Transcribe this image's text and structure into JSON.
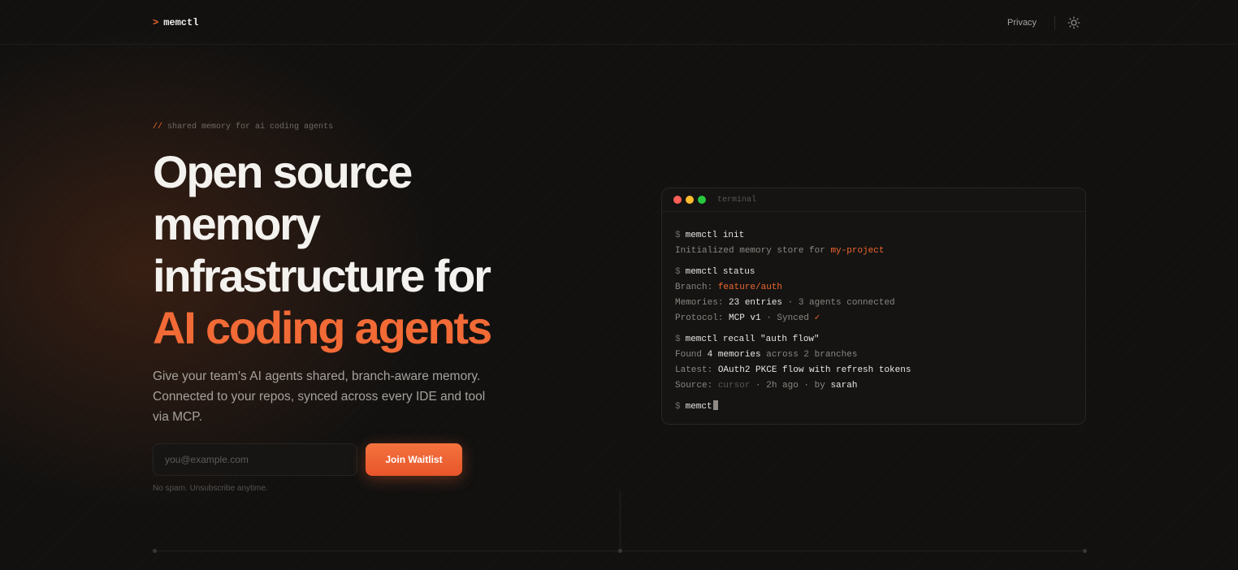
{
  "nav": {
    "logo_prompt": ">",
    "logo_text": "memctl",
    "privacy_link": "Privacy",
    "theme_toggle_icon": "sun-icon"
  },
  "hero": {
    "kicker_prefix": "//",
    "kicker_text": "shared memory for ai coding agents",
    "headline_lines": [
      "Open source",
      "memory",
      "infrastructure for"
    ],
    "headline_accent": "AI coding agents",
    "subtext": "Give your team's AI agents shared, branch-aware memory. Connected to your repos, synced across every IDE and tool via MCP.",
    "email_placeholder": "you@example.com",
    "email_value": "",
    "join_button": "Join Waitlist",
    "fineprint": "No spam. Unsubscribe anytime."
  },
  "terminal": {
    "title": "terminal",
    "prompt_symbol": "$",
    "cmd1": "memctl init",
    "out1_text": "Initialized memory store for ",
    "out1_project": "my-project",
    "cmd2": "memctl status",
    "branch_label": "Branch: ",
    "branch_value": "feature/auth",
    "memories_label": "Memories: ",
    "memories_value": "23 entries",
    "memories_rest": " · 3 agents connected",
    "protocol_label": "Protocol: ",
    "protocol_value": "MCP v1",
    "protocol_rest": " · Synced ",
    "protocol_check": "✓",
    "cmd3": "memctl recall \"auth flow\"",
    "found_label": "Found ",
    "found_value": "4 memories",
    "found_rest": " across 2 branches",
    "latest_label": "Latest: ",
    "latest_value": "OAuth2 PKCE flow with refresh tokens",
    "source_label": "Source: ",
    "source_tool": "cursor",
    "source_time": " · 2h ago · by ",
    "source_user": "sarah",
    "cmd4_typing": "memct"
  },
  "colors": {
    "accent": "#f26a36",
    "background": "#121110",
    "terminal_bg": "#151413"
  }
}
